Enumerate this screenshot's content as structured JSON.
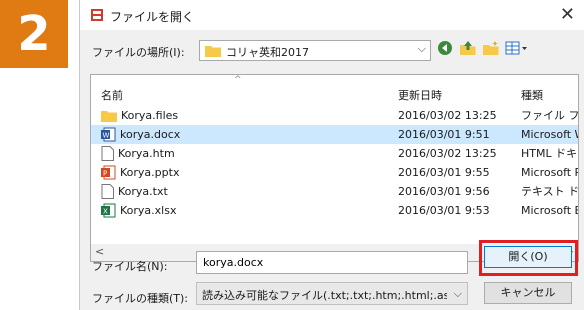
{
  "step_number": "2",
  "dialog": {
    "title": "ファイルを開く",
    "close_glyph": "✕"
  },
  "lookin": {
    "label": "ファイルの場所(I):",
    "value": "コリャ英和2017",
    "arrow": "⌵"
  },
  "filelist": {
    "columns": [
      "名前",
      "更新日時",
      "種類"
    ],
    "sort_glyph": "^",
    "rows": [
      {
        "name": "Korya.files",
        "date": "2016/03/02 13:25",
        "type": "ファイル フォルダー",
        "icon": "folder-icon"
      },
      {
        "name": "korya.docx",
        "date": "2016/03/01 9:51",
        "type": "Microsoft Wor",
        "icon": "word-icon"
      },
      {
        "name": "Korya.htm",
        "date": "2016/03/02 13:25",
        "type": "HTML ドキュメン",
        "icon": "document-icon"
      },
      {
        "name": "Korya.pptx",
        "date": "2016/03/01 9:55",
        "type": "Microsoft Pow",
        "icon": "powerpoint-icon"
      },
      {
        "name": "Korya.txt",
        "date": "2016/03/01 9:56",
        "type": "テキスト ドキュメン",
        "icon": "document-icon"
      },
      {
        "name": "Korya.xlsx",
        "date": "2016/03/01 9:53",
        "type": "Microsoft Exce",
        "icon": "excel-icon"
      }
    ],
    "selected_row": 1,
    "scroll_left": "<",
    "scroll_right": ">"
  },
  "filename": {
    "label": "ファイル名(N):",
    "value": "korya.docx"
  },
  "filetype": {
    "label": "ファイルの種類(T):",
    "value": "読み込み可能なファイル(.txt;.txt;.htm;.html;.asp;.a",
    "arrow": "⌵"
  },
  "buttons": {
    "open": "開く(O)",
    "cancel": "キャンセル"
  },
  "colors": {
    "step_badge": "#e07a12",
    "selection": "#cce8ff",
    "highlight": "#e02020"
  }
}
